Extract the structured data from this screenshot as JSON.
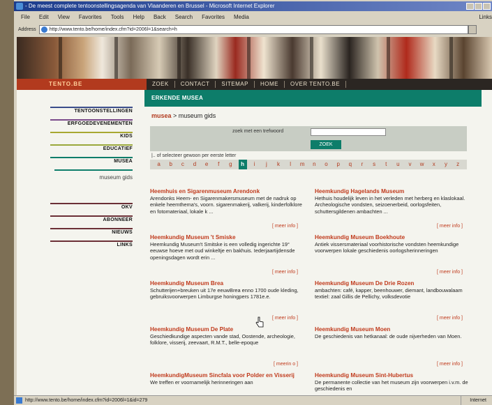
{
  "window": {
    "title": "- De meest complete tentoonstellingsagenda van Vlaanderen en Brussel - Microsoft Internet Explorer"
  },
  "menu": [
    "File",
    "Edit",
    "View",
    "Favorites",
    "Tools",
    "Help",
    "Back",
    "Search",
    "Favorites",
    "Media",
    "Links"
  ],
  "address": {
    "label": "Address",
    "url": "http://www.tento.be/home/index.cfm?id=2006l=1&search=h"
  },
  "nav": {
    "logo": "TENTO.BE",
    "items": [
      "ZOEK",
      "CONTACT",
      "SITEMAP",
      "HOME",
      "OVER TENTO.BE"
    ]
  },
  "sidebar": {
    "items": [
      {
        "label": "TENTOONSTELLINGEN",
        "color": "#3a4c8a"
      },
      {
        "label": "ERFGOEDEVENEMENTEN",
        "color": "#7a4a8a"
      },
      {
        "label": "KIDS",
        "color": "#a8a830"
      },
      {
        "label": "EDUCATIEF",
        "color": "#9aa83a"
      },
      {
        "label": "MUSEA",
        "color": "#0d7d6a"
      }
    ],
    "sub": "museum gids",
    "items2": [
      {
        "label": "OKV",
        "color": "#6b2f36"
      },
      {
        "label": "ABONNEER",
        "color": "#6b2f36"
      },
      {
        "label": "NIEUWS",
        "color": "#6b2f36"
      },
      {
        "label": "LINKS",
        "color": "#6b2f36"
      }
    ]
  },
  "main": {
    "header": "ERKENDE MUSEA",
    "crumb_link": "musea",
    "crumb_rest": " > museum gids",
    "search_label": "zoek met een trefwoord",
    "search_button": "ZOEK",
    "or_select": "|.. of selecteer gewoon per eerste letter",
    "letters": [
      "a",
      "b",
      "c",
      "d",
      "e",
      "f",
      "g",
      "h",
      "i",
      "j",
      "k",
      "l",
      "m",
      "n",
      "o",
      "p",
      "q",
      "r",
      "s",
      "t",
      "u",
      "v",
      "w",
      "x",
      "y",
      "z"
    ],
    "active_letter": "h",
    "museums": [
      {
        "title": "Heemhuis en Sigarenmuseum Arendonk",
        "desc": "Arendonks Heem- en Sigarenmakersmuseum met de nadruk op enkele heemthema's, voorn. sigarenmakerij, valkerij, kinderfolklore en fotomateriaal, lokale k ...",
        "more": "[ meer info ]"
      },
      {
        "title": "Heemkundig Hagelands Museum",
        "desc": "Hethuis houdelijk leven in het verleden met herberg en klaslokaal. Archeologische vondsten, seizoenerbeid, oorlogsfeiten, schuttersgildenen ambachten ...",
        "more": "[ meer info ]"
      },
      {
        "title": "Heemkundig Museum 't Smiske",
        "desc": "Heemkundig Museum't Smitske is een volledig ingerichte 19° eeuwse hoeve met oud winkeltje en bakhuis. Iederjaartijdensde openingsdagen wordt erin ...",
        "more": "[ meer info ]"
      },
      {
        "title": "Heemkundig Museum Boekhoute",
        "desc": "Antiek vissersmateriaal voorhistorische vondsten heemkundige voorwerpen lokale geschiedenis oorlogsherinneringen",
        "more": "[ meer info ]"
      },
      {
        "title": "Heemkundig Museum Brea",
        "desc": "Schutterijen+breuken uit 17e eeuwBrea enno 1700 oude kleding, gebruiksvoorwerpen Limburgse honingpers 1781e.e.",
        "more": "[ meer info ]"
      },
      {
        "title": "Heemkundig Museum De Drie Rozen",
        "desc": "ambachten: café, kapper, beenhouwer, diemant, landbouwalaam textiel: zaal Gillis de Pellichy, volksdevotie",
        "more": "[ meer info ]"
      },
      {
        "title": "Heemkundig Museum De Plate",
        "desc": "Geschiedkundige aspecten vande stad, Oostende, archeologie, folklore, visserij, zeevaart, R.M.T., belle-epoque",
        "more": "[ meerin o ]"
      },
      {
        "title": "Heemkundig Museum Moen",
        "desc": "De geschiedenis van hetkanaal: de oude nijverheden van Moen.",
        "more": "[ meer info ]"
      },
      {
        "title": "HeemkundigMuseum Sincfala voor Polder en Visserij",
        "desc": "We treffen er voornamelijk herinneringen aan",
        "more": ""
      },
      {
        "title": "Heemkundig Museum Sint-Hubertus",
        "desc": "De permanente collectie van het museum zijn voorwerpen i.v.m. de geschiedenis en",
        "more": ""
      }
    ]
  },
  "status": {
    "url": "http://www.tento.be/home/index.cfm?id=2006l=1&id=279",
    "zone": "Internet"
  }
}
